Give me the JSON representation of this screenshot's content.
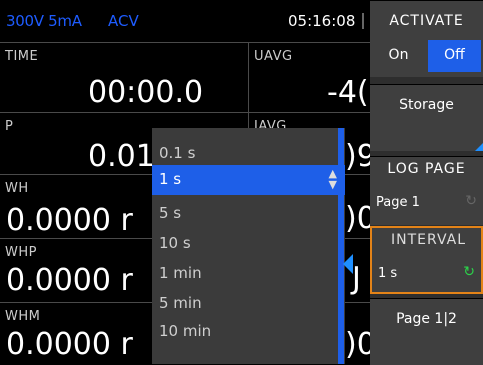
{
  "status": {
    "range": "300V 5mA",
    "mode": "ACV",
    "clock": "05:16:08"
  },
  "cells": {
    "time": {
      "label": "TIME",
      "value": "00:00.0"
    },
    "uavg": {
      "label": "UAVG",
      "value": "-4("
    },
    "p": {
      "label": "P",
      "value": "0.01"
    },
    "iavg": {
      "label": "IAVG",
      "value": ")9"
    },
    "wh": {
      "label": "WH",
      "value": "0.0000 r"
    },
    "wh_right": {
      "value": ")0"
    },
    "whp": {
      "label": "WHP",
      "value": "0.0000 r"
    },
    "whp_right": {
      "value": "J"
    },
    "whm": {
      "label": "WHM",
      "value": "0.0000 r"
    },
    "whm_right": {
      "value": ")0"
    }
  },
  "dropdown": {
    "options": [
      "0.1 s",
      "1 s",
      "5 s",
      "10 s",
      "1 min",
      "5 min",
      "10 min"
    ],
    "selected": "1 s"
  },
  "side": {
    "activate": {
      "title": "ACTIVATE",
      "on": "On",
      "off": "Off",
      "state": "Off"
    },
    "storage": "Storage",
    "log_page": {
      "title": "LOG PAGE",
      "value": "Page 1"
    },
    "interval": {
      "title": "INTERVAL",
      "value": "1 s"
    },
    "page": "Page 1|2"
  },
  "colors": {
    "accent": "#1e5fe8",
    "highlight": "#e38318",
    "knob": "#2bd44a"
  }
}
